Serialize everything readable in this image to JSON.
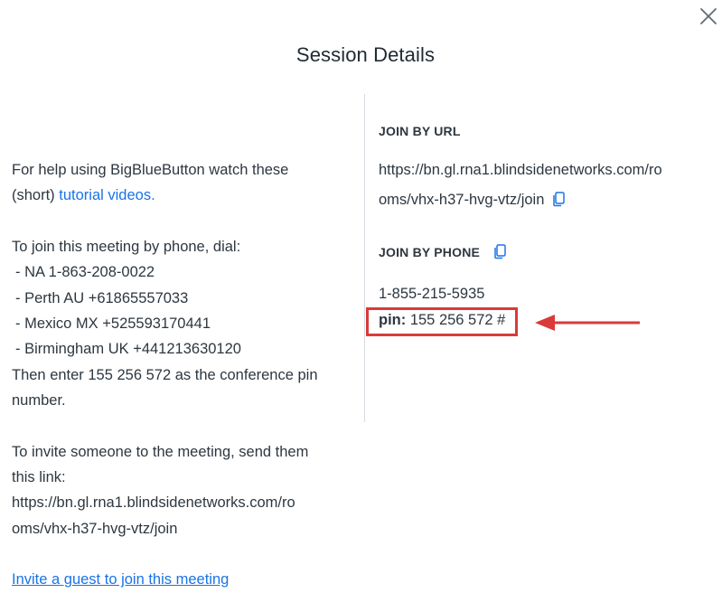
{
  "modal": {
    "title": "Session Details",
    "close_icon": "close-icon"
  },
  "help": {
    "line1": "For help using BigBlueButton watch these",
    "prefix": "(short) ",
    "link_text": "tutorial videos."
  },
  "phone_info": {
    "intro": "To join this meeting by phone, dial:",
    "numbers": [
      "- NA 1-863-208-0022",
      "- Perth AU +61865557033",
      "- Mexico MX +525593170441",
      "- Birmingham UK +441213630120"
    ],
    "pin_line1": "Then enter 155 256 572 as the conference pin",
    "pin_line2": "number."
  },
  "invite": {
    "line1": "To invite someone to the meeting, send them",
    "line2": "this link:",
    "url_line1": "https://bn.gl.rna1.blindsidenetworks.com/ro",
    "url_line2": "oms/vhx-h37-hvg-vtz/join",
    "guest_link": "Invite a guest to join this meeting"
  },
  "join_by_url": {
    "label": "JOIN BY URL",
    "url_line1": "https://bn.gl.rna1.blindsidenetworks.com/ro",
    "url_line2": "oms/vhx-h37-hvg-vtz/join",
    "copy_icon": "copy-icon"
  },
  "join_by_phone": {
    "label": "JOIN BY PHONE",
    "copy_icon": "copy-icon",
    "number": "1-855-215-5935",
    "pin_label": "pin:",
    "pin_value": " 155 256 572 #"
  },
  "annotation": {
    "highlight_color": "#d93a3a",
    "arrow_icon": "arrow-left-icon"
  }
}
